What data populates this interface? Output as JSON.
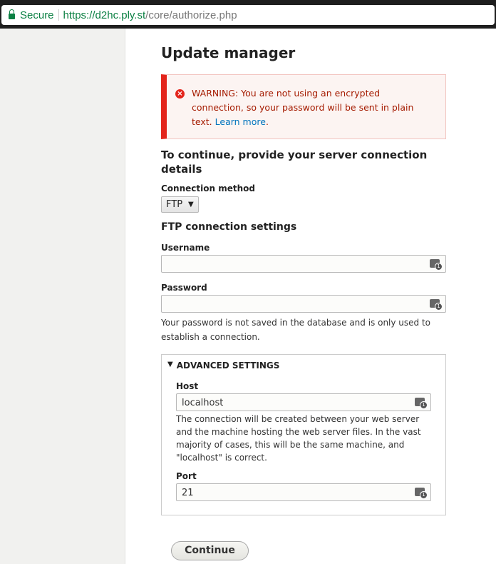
{
  "browser": {
    "secure": "Secure",
    "host": "https://d2hc.ply.st",
    "path": "/core/authorize.php"
  },
  "page": {
    "title": "Update manager",
    "warning": {
      "text": "WARNING: You are not using an encrypted connection, so your password will be sent in plain text.",
      "link": "Learn more",
      "after": "."
    },
    "heading": "To continue, provide your server connection details",
    "connection_method_label": "Connection method",
    "connection_method_value": "FTP",
    "ftp_heading": "FTP connection settings",
    "username_label": "Username",
    "username_value": "",
    "password_label": "Password",
    "password_value": "",
    "password_desc": "Your password is not saved in the database and is only used to establish a connection.",
    "advanced": {
      "title": "ADVANCED SETTINGS",
      "host_label": "Host",
      "host_value": "localhost",
      "host_desc": "The connection will be created between your web server and the machine hosting the web server files. In the vast majority of cases, this will be the same machine, and \"localhost\" is correct.",
      "port_label": "Port",
      "port_value": "21"
    },
    "continue": "Continue"
  }
}
